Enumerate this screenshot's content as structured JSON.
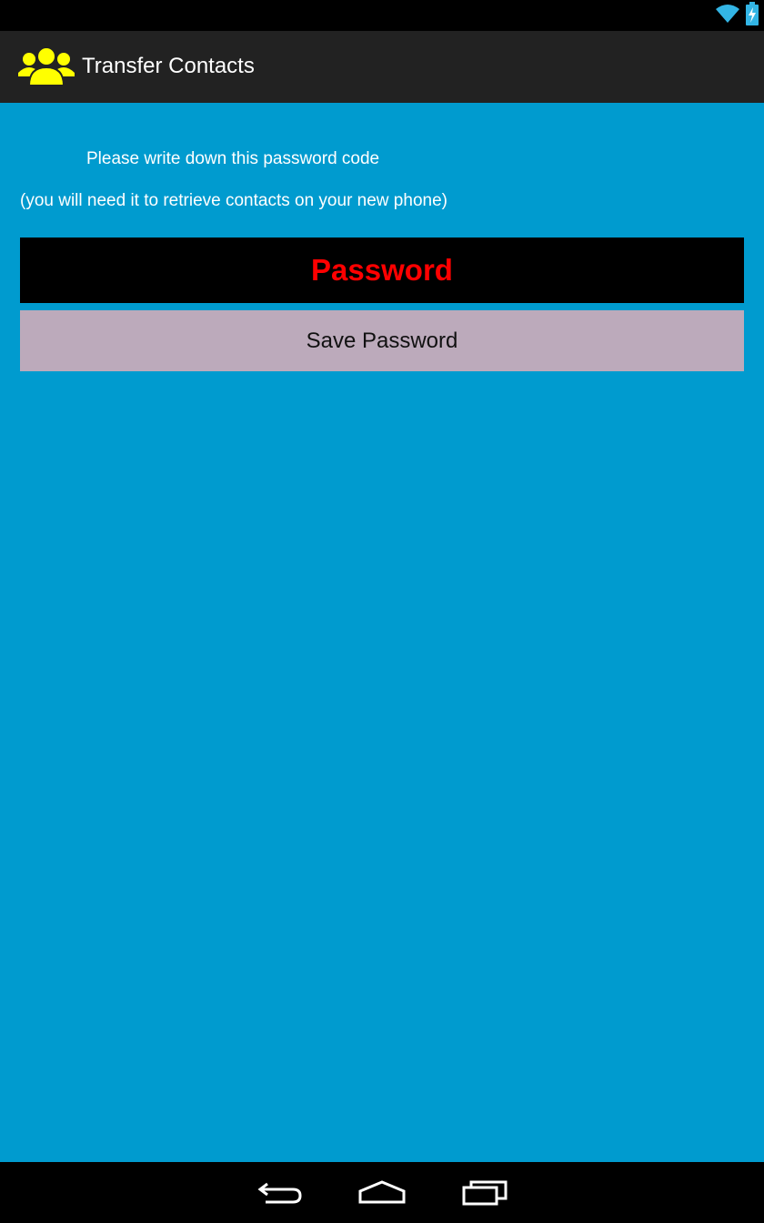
{
  "status_bar": {
    "icons": [
      "wifi-icon",
      "battery-charging-icon"
    ]
  },
  "action_bar": {
    "app_icon": "contacts-group-icon",
    "title": "Transfer Contacts"
  },
  "content": {
    "instruction_line_1": "Please write down this password code",
    "instruction_line_2": "(you will need it to retrieve contacts on your new phone)",
    "password_value": "Password",
    "save_button_label": "Save Password"
  },
  "nav_bar": {
    "icons": [
      "back-icon",
      "home-icon",
      "recent-apps-icon"
    ]
  },
  "colors": {
    "background": "#009bcf",
    "action_bar": "#222222",
    "password_text": "#ff0000",
    "save_button": "#bcaabb",
    "app_icon": "#ffff00"
  }
}
